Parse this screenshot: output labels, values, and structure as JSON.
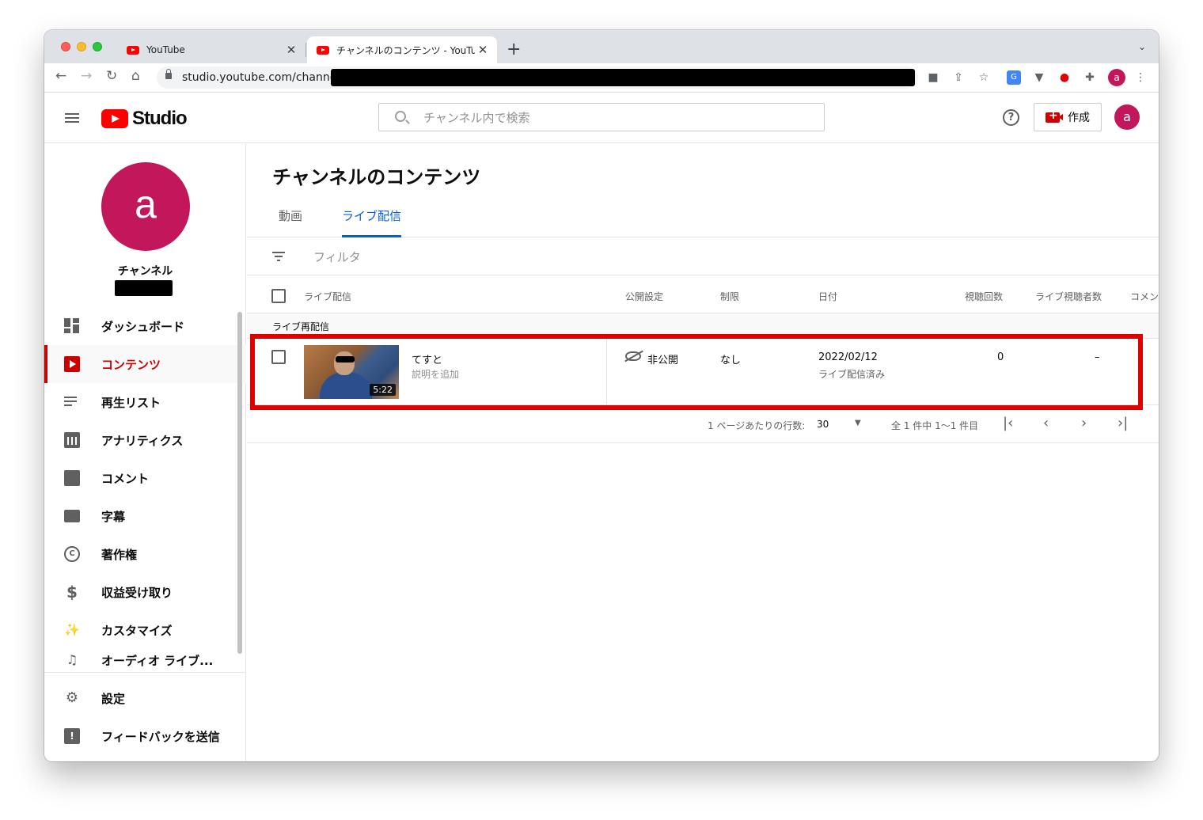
{
  "browser": {
    "tabs": [
      {
        "title": "YouTube"
      },
      {
        "title": "チャンネルのコンテンツ - YouTube Studio"
      }
    ],
    "url": "studio.youtube.com/channel/",
    "profile_initial": "a"
  },
  "header": {
    "logo_text": "Studio",
    "search_placeholder": "チャンネル内で検索",
    "create_label": "作成",
    "avatar_initial": "a"
  },
  "sidebar": {
    "avatar_initial": "a",
    "channel_label": "チャンネル",
    "items": [
      {
        "label": "ダッシュボード",
        "icon": "dashboard-icon"
      },
      {
        "label": "コンテンツ",
        "icon": "content-icon",
        "active": true
      },
      {
        "label": "再生リスト",
        "icon": "playlist-icon"
      },
      {
        "label": "アナリティクス",
        "icon": "analytics-icon"
      },
      {
        "label": "コメント",
        "icon": "comment-icon"
      },
      {
        "label": "字幕",
        "icon": "subtitles-icon"
      },
      {
        "label": "著作権",
        "icon": "copyright-icon"
      },
      {
        "label": "収益受け取り",
        "icon": "dollar-icon"
      },
      {
        "label": "カスタマイズ",
        "icon": "magic-wand-icon"
      },
      {
        "label": "オーディオ ライブ...",
        "icon": "audio-library-icon"
      }
    ],
    "bottom_items": [
      {
        "label": "設定",
        "icon": "gear-icon"
      },
      {
        "label": "フィードバックを送信",
        "icon": "feedback-icon"
      }
    ]
  },
  "main": {
    "title": "チャンネルのコンテンツ",
    "tabs": [
      {
        "label": "動画"
      },
      {
        "label": "ライブ配信",
        "active": true
      }
    ],
    "filter_placeholder": "フィルタ",
    "columns": {
      "video": "ライブ配信",
      "visibility": "公開設定",
      "restrictions": "制限",
      "date": "日付",
      "views": "視聴回数",
      "live_viewers": "ライブ視聴者数",
      "comments": "コメン"
    },
    "section_label": "ライブ再配信",
    "rows": [
      {
        "title": "てすと",
        "description": "説明を追加",
        "duration": "5:22",
        "visibility": "非公開",
        "restrictions": "なし",
        "date": "2022/02/12",
        "date_note": "ライブ配信済み",
        "views": "0",
        "live_viewers": "–"
      }
    ],
    "pagination": {
      "rows_per_page_label": "1 ページあたりの行数:",
      "rows_per_page_value": "30",
      "range": "全 1 件中 1〜1 件目"
    },
    "highlight_color": "#e00000"
  }
}
